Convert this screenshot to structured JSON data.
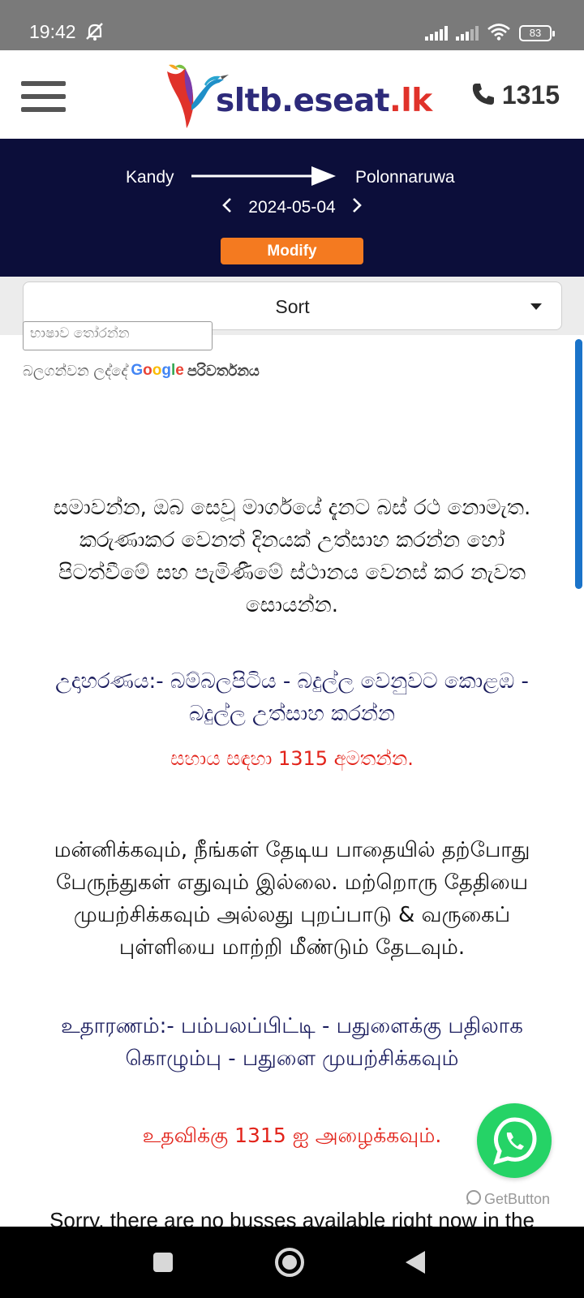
{
  "status_bar": {
    "time": "19:42",
    "battery": "83",
    "icons": [
      "mute-icon",
      "signal-icon",
      "signal-icon",
      "wifi-icon",
      "battery-icon"
    ]
  },
  "header": {
    "logo": {
      "part1": "sltb.",
      "part2": "eseat",
      "part3": ".lk"
    },
    "phone_number": "1315",
    "icons": [
      "menu-icon",
      "phone-icon"
    ]
  },
  "route": {
    "from": "Kandy",
    "to": "Polonnaruwa",
    "date": "2024-05-04",
    "modify_label": "Modify"
  },
  "sort": {
    "label": "Sort"
  },
  "translate": {
    "select_text": "භාෂාව තෝරන්න",
    "credit_prefix": "බලගන්වන ලද්දේ",
    "google": "Google",
    "translate_label": "පරිවර්තනය"
  },
  "messages": {
    "sinhala_main": "සමාවන්න, ඔබ සෙවූ මාර්ගයේ දැනට බස් රථ නොමැත. කරුණාකර වෙනත් දිනයක් උත්සාහ කරන්න හෝ පිටත්වීමේ සහ පැමිණීමේ ස්ථානය වෙනස් කර නැවත සොයන්න.",
    "sinhala_example": "උදාහරණය:- බම්බලපිටිය - බදුල්ල වෙනුවට කොළඹ - බදුල්ල උත්සාහ කරන්න",
    "sinhala_help": "සහාය සඳහා 1315 අමතන්න.",
    "tamil_main": "மன்னிக்கவும், நீங்கள் தேடிய பாதையில் தற்போது பேருந்துகள் எதுவும் இல்லை. மற்றொரு தேதியை முயற்சிக்கவும் அல்லது புறப்பாடு & வருகைப் புள்ளியை மாற்றி மீண்டும் தேடவும்.",
    "tamil_example": "உதாரணம்:- பம்பலப்பிட்டி - பதுளைக்கு பதிலாக கொழும்பு - பதுளை முயற்சிக்கவும்",
    "tamil_help": "உதவிக்கு 1315 ஐ அழைக்கவும்.",
    "english_main": "Sorry, there are no busses available right now in the"
  },
  "widgets": {
    "getbutton_label": "GetButton",
    "whatsapp_icon": "whatsapp-icon"
  },
  "colors": {
    "banner": "#0c0e3a",
    "modify": "#f47a20",
    "help_red": "#e2231a",
    "example_navy": "#1b1d5e",
    "whatsapp": "#25d366",
    "scrollbar": "#1a73c9"
  }
}
